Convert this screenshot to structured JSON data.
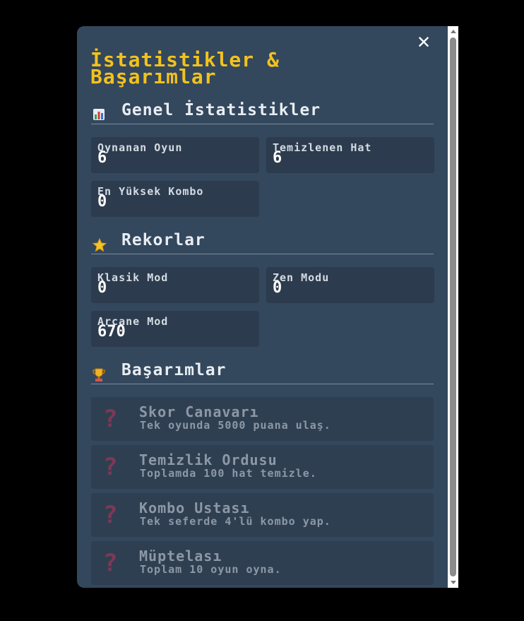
{
  "modal": {
    "title": "İstatistikler & Başarımlar",
    "close_label": "✕"
  },
  "colors": {
    "panel": "#33475d",
    "title": "#f2c21d",
    "locked_icon": "#7e3855"
  },
  "general": {
    "heading": "Genel İstatistikler",
    "icon": "bar-chart-icon",
    "stats": [
      {
        "label": "Oynanan Oyun",
        "value": "6"
      },
      {
        "label": "Temizlenen Hat",
        "value": "6"
      },
      {
        "label": "En Yüksek Kombo",
        "value": "0"
      }
    ]
  },
  "records": {
    "heading": "Rekorlar",
    "icon": "star-icon",
    "stats": [
      {
        "label": "Klasik Mod",
        "value": "0"
      },
      {
        "label": "Zen Modu",
        "value": "0"
      },
      {
        "label": "Arcane Mod",
        "value": "670"
      }
    ]
  },
  "achievements": {
    "heading": "Başarımlar",
    "icon": "trophy-icon",
    "locked_glyph": "?",
    "items": [
      {
        "title": "Skor Canavarı",
        "desc": "Tek oyunda 5000 puana ulaş."
      },
      {
        "title": "Temizlik Ordusu",
        "desc": "Toplamda 100 hat temizle."
      },
      {
        "title": "Kombo Ustası",
        "desc": "Tek seferde 4'lü kombo yap."
      },
      {
        "title": "Müptelası",
        "desc": "Toplam 10 oyun oyna."
      }
    ]
  }
}
